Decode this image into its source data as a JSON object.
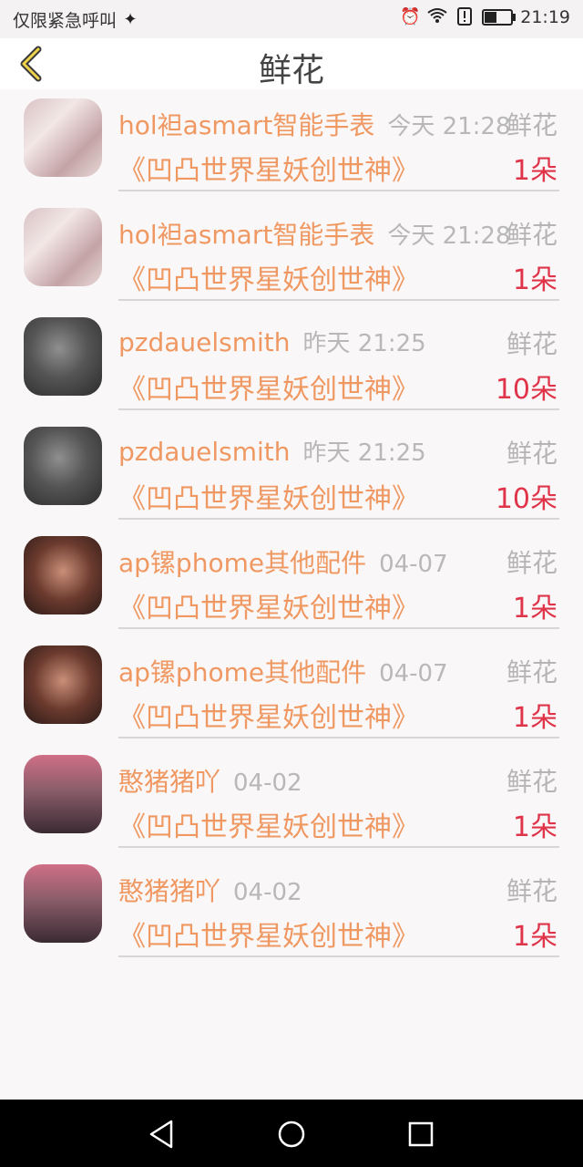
{
  "status_bar": {
    "left_text": "仅限紧急呼叫",
    "time": "21:19",
    "icons": [
      "bulb-icon",
      "alarm-icon",
      "wifi-icon",
      "alert-icon",
      "battery-icon"
    ],
    "battery_level": 0.45
  },
  "header": {
    "title": "鲜花",
    "back_icon": "chevron-left-icon"
  },
  "items": [
    {
      "name": "hol袒asmart智能手表",
      "time": "今天 21:28",
      "type": "鲜花",
      "desc": "《凹凸世界星妖创世神》",
      "count": "1朵",
      "avatar": "avatar-girl"
    },
    {
      "name": "hol袒asmart智能手表",
      "time": "今天 21:28",
      "type": "鲜花",
      "desc": "《凹凸世界星妖创世神》",
      "count": "1朵",
      "avatar": "avatar-girl"
    },
    {
      "name": "pzdauelsmith",
      "time": "昨天 21:25",
      "type": "鲜花",
      "desc": "《凹凸世界星妖创世神》",
      "count": "10朵",
      "avatar": "avatar-man"
    },
    {
      "name": "pzdauelsmith",
      "time": "昨天 21:25",
      "type": "鲜花",
      "desc": "《凹凸世界星妖创世神》",
      "count": "10朵",
      "avatar": "avatar-man"
    },
    {
      "name": "ap镙phome其他配件",
      "time": "04-07",
      "type": "鲜花",
      "desc": "《凹凸世界星妖创世神》",
      "count": "1朵",
      "avatar": "avatar-woman"
    },
    {
      "name": "ap镙phome其他配件",
      "time": "04-07",
      "type": "鲜花",
      "desc": "《凹凸世界星妖创世神》",
      "count": "1朵",
      "avatar": "avatar-woman"
    },
    {
      "name": "憨猪猪吖",
      "time": "04-02",
      "type": "鲜花",
      "desc": "《凹凸世界星妖创世神》",
      "count": "1朵",
      "avatar": "avatar-cartoon"
    },
    {
      "name": "憨猪猪吖",
      "time": "04-02",
      "type": "鲜花",
      "desc": "《凹凸世界星妖创世神》",
      "count": "1朵",
      "avatar": "avatar-cartoon"
    }
  ],
  "nav_bar": {
    "icons": [
      "back-triangle-icon",
      "home-circle-icon",
      "recents-square-icon"
    ]
  },
  "colors": {
    "accent": "#ef9862",
    "count": "#e0344a",
    "muted": "#b5b5b5",
    "background": "#faf7f8"
  }
}
